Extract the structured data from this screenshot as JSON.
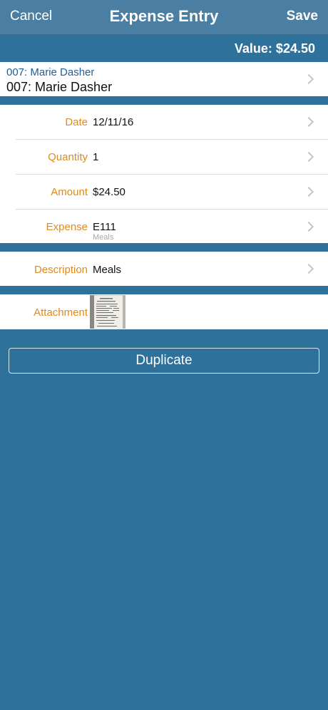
{
  "navbar": {
    "cancel_label": "Cancel",
    "title": "Expense Entry",
    "save_label": "Save"
  },
  "value_label": "Value: $24.50",
  "client": {
    "line1": "007: Marie Dasher",
    "line2": "007: Marie Dasher"
  },
  "fields": {
    "date": {
      "label": "Date",
      "value": "12/11/16"
    },
    "quantity": {
      "label": "Quantity",
      "value": "1"
    },
    "amount": {
      "label": "Amount",
      "value": "$24.50"
    },
    "expense": {
      "label": "Expense",
      "value": "E111",
      "sub": "Meals"
    },
    "description": {
      "label": "Description",
      "value": "Meals"
    },
    "attachment": {
      "label": "Attachment"
    }
  },
  "duplicate_label": "Duplicate",
  "colors": {
    "accent_label": "#e08a1b",
    "background": "#2e719b",
    "navbar": "#4a7fa3",
    "client_link": "#1f5d93"
  },
  "icons": {
    "row_disclosure": "chevron-right-icon"
  }
}
